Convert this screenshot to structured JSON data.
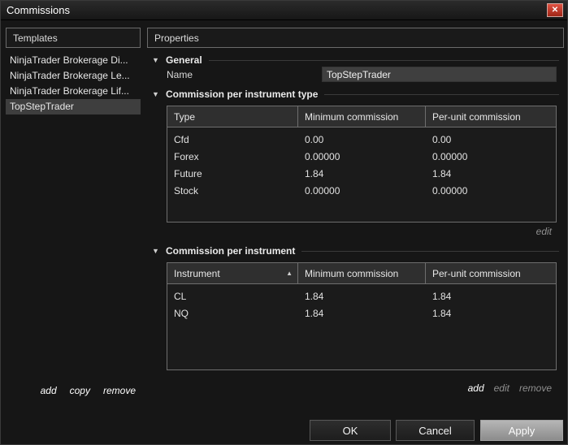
{
  "window": {
    "title": "Commissions"
  },
  "icons": {
    "close": "✕",
    "section_collapse": "▼",
    "sort_asc": "▲"
  },
  "templates": {
    "header": "Templates",
    "items": [
      {
        "label": "NinjaTrader Brokerage Di..."
      },
      {
        "label": "NinjaTrader Brokerage Le..."
      },
      {
        "label": "NinjaTrader Brokerage Lif..."
      },
      {
        "label": "TopStepTrader"
      }
    ],
    "actions": {
      "add": "add",
      "copy": "copy",
      "remove": "remove"
    }
  },
  "properties": {
    "header": "Properties",
    "general": {
      "title": "General",
      "name_label": "Name",
      "name_value": "TopStepTrader"
    },
    "per_type": {
      "title": "Commission per instrument type",
      "columns": [
        "Type",
        "Minimum commission",
        "Per-unit commission"
      ],
      "rows": [
        [
          "Cfd",
          "0.00",
          "0.00"
        ],
        [
          "Forex",
          "0.00000",
          "0.00000"
        ],
        [
          "Future",
          "1.84",
          "1.84"
        ],
        [
          "Stock",
          "0.00000",
          "0.00000"
        ]
      ],
      "actions": {
        "edit": "edit"
      }
    },
    "per_instrument": {
      "title": "Commission per instrument",
      "columns": [
        "Instrument",
        "Minimum commission",
        "Per-unit commission"
      ],
      "sorted_column": "Instrument",
      "rows": [
        [
          "CL",
          "1.84",
          "1.84"
        ],
        [
          "NQ",
          "1.84",
          "1.84"
        ]
      ],
      "actions": {
        "add": "add",
        "edit": "edit",
        "remove": "remove"
      }
    }
  },
  "footer": {
    "ok": "OK",
    "cancel": "Cancel",
    "apply": "Apply"
  },
  "colors": {
    "close_red": "#b0291a",
    "selected_bg": "#3e3e3e",
    "window_bg": "#161616"
  }
}
